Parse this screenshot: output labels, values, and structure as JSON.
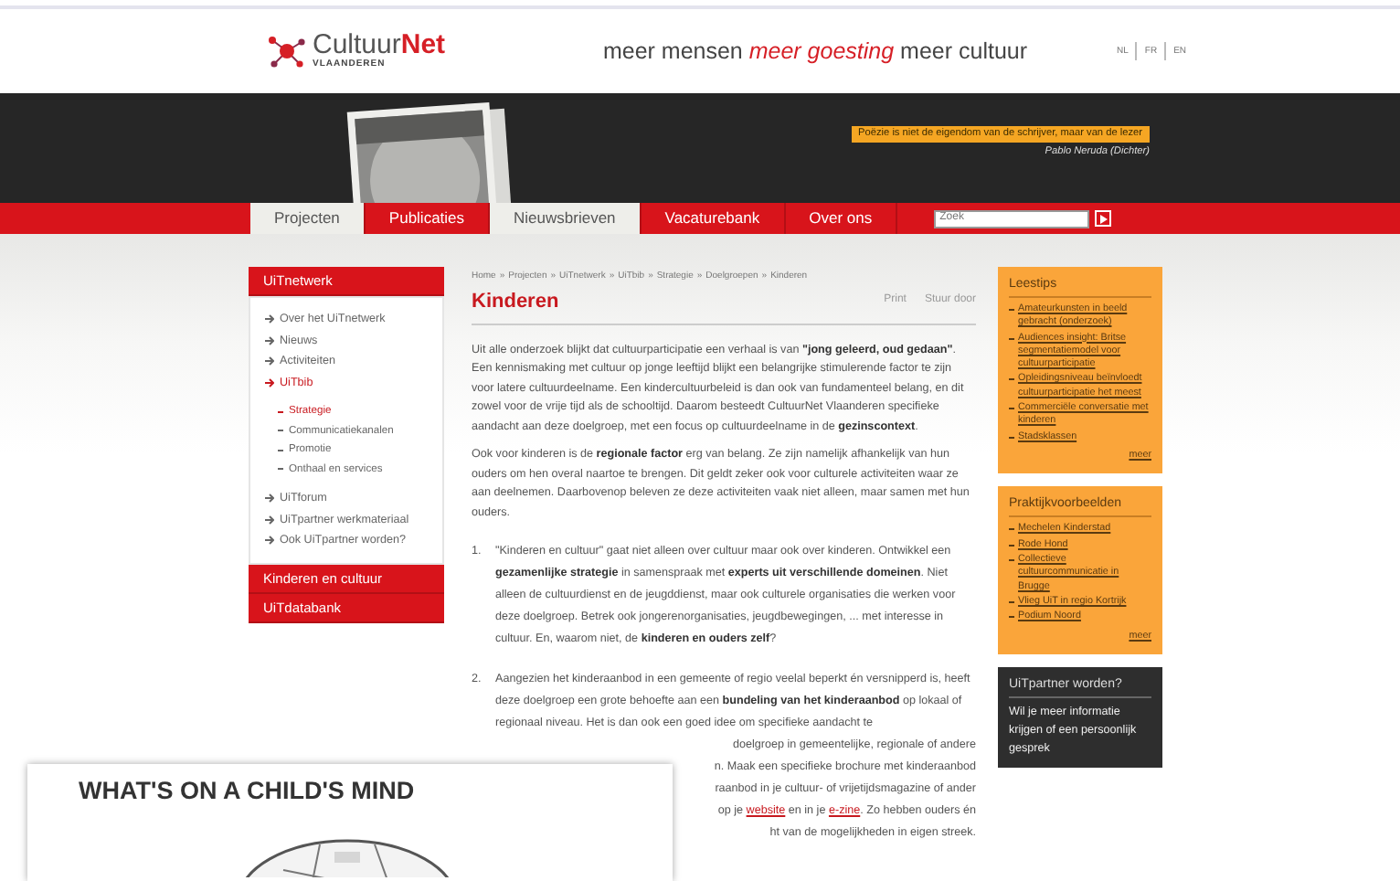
{
  "header": {
    "logo": {
      "brand_first": "Cultuur",
      "brand_second": "Net",
      "subtitle": "VLAANDEREN"
    },
    "tagline": "meer mensen *meer goesting* meer cultuur",
    "languages": [
      "NL",
      "FR",
      "EN"
    ]
  },
  "banner": {
    "quote": "Poëzie is niet de eigendom van de schrijver, maar van de lezer",
    "author": "Pablo Neruda (Dichter)"
  },
  "nav": {
    "tabs": [
      {
        "label": "Projecten",
        "selected": true
      },
      {
        "label": "Publicaties",
        "selected": false
      },
      {
        "label": "Nieuwsbrieven",
        "selected": true
      },
      {
        "label": "Vacaturebank",
        "selected": false
      },
      {
        "label": "Over ons",
        "selected": false
      }
    ],
    "search": {
      "placeholder": "Zoek"
    }
  },
  "sidebar": {
    "sections": [
      {
        "title": "UiTnetwerk",
        "expanded": true,
        "items": [
          {
            "label": "Over het UiTnetwerk",
            "selected": false
          },
          {
            "label": "Nieuws",
            "selected": false
          },
          {
            "label": "Activiteiten",
            "selected": false
          },
          {
            "label": "UiTbib",
            "selected": true,
            "children": [
              {
                "label": "Strategie",
                "selected": true
              },
              {
                "label": "Communicatiekanalen",
                "selected": false
              },
              {
                "label": "Promotie",
                "selected": false
              },
              {
                "label": "Onthaal en services",
                "selected": false
              }
            ]
          },
          {
            "label": "UiTforum",
            "selected": false
          },
          {
            "label": "UiTpartner werkmateriaal",
            "selected": false
          },
          {
            "label": "Ook UiTpartner worden?",
            "selected": false
          }
        ]
      },
      {
        "title": "Kinderen en cultuur",
        "expanded": false
      },
      {
        "title": "UiTdatabank",
        "expanded": false
      }
    ]
  },
  "main": {
    "breadcrumb": [
      "Home",
      "Projecten",
      "UiTnetwerk",
      "UiTbib",
      "Strategie",
      "Doelgroepen",
      "Kinderen"
    ],
    "breadcrumb_separator": "»",
    "title": "Kinderen",
    "actions": [
      "Print",
      "Stuur door"
    ],
    "paragraphs": [
      "Uit alle onderzoek blijkt dat cultuurparticipatie een verhaal is van **\"jong geleerd, oud gedaan\"**. Een kennismaking met cultuur op jonge leeftijd blijkt een belangrijke stimulerende factor te zijn voor latere cultuurdeelname. Een kindercultuurbeleid is dan ook van fundamenteel belang, en dit zowel voor de vrije tijd als de schooltijd. Daarom besteedt CultuurNet Vlaanderen specifieke aandacht aan deze doelgroep, met een focus op cultuurdeelname in de **gezinscontext**.",
      "Ook voor kinderen is de **regionale factor** erg van belang. Ze zijn namelijk afhankelijk van hun ouders om hen overal naartoe te brengen. Dit geldt zeker ook voor culturele activiteiten waar ze aan deelnemen. Daarbovenop beleven ze deze activiteiten vaak niet alleen, maar samen met hun ouders."
    ],
    "list": [
      {
        "number": "1.",
        "text": "\"Kinderen en cultuur\" gaat niet alleen over cultuur maar ook over kinderen. Ontwikkel een **gezamenlijke strategie** in samenspraak met **experts uit verschillende domeinen**. Niet alleen de cultuurdienst en de jeugddienst, maar ook culturele organisaties die werken voor deze doelgroep. Betrek ook jongerenorganisaties, jeugdbewegingen, ... met interesse in cultuur. En, waarom niet, de **kinderen en ouders zelf**?"
      },
      {
        "number": "2.",
        "text": "Aangezien het kinderaanbod in een gemeente of regio veelal beperkt én versnipperd is, heeft deze doelgroep een grote behoefte aan een **bundeling van het kinderaanbod** op lokaal of regionaal niveau. Het is dan ook een goed idee om specifieke aandacht te",
        "partial_lines": [
          [
            {
              "kind": "text",
              "text": "doelgroep in gemeentelijke, regionale of andere"
            }
          ],
          [
            {
              "kind": "text",
              "text": "n. Maak een specifieke brochure met kinderaanbod"
            }
          ],
          [
            {
              "kind": "text",
              "text": "raanbod in je cultuur- of vrijetijdsmagazine of ander"
            }
          ],
          [
            {
              "kind": "text",
              "text": "op je "
            },
            {
              "kind": "link",
              "text": "website"
            },
            {
              "kind": "text",
              "text": " en in je "
            },
            {
              "kind": "link",
              "text": "e-zine"
            },
            {
              "kind": "text",
              "text": ". Zo hebben ouders én"
            }
          ],
          [
            {
              "kind": "text",
              "text": "ht van de mogelijkheden in eigen streek."
            }
          ]
        ]
      }
    ]
  },
  "boxes": [
    {
      "kind": "orange",
      "title": "Leestips",
      "links": [
        "Amateurkunsten in beeld gebracht (onderzoek)",
        "Audiences insight: Britse segmentatiemodel voor cultuurparticipatie",
        "Opleidingsniveau beïnvloedt cultuurparticipatie het meest",
        "Commerciële conversatie met kinderen",
        "Stadsklassen"
      ],
      "more": "meer"
    },
    {
      "kind": "orange",
      "title": "Praktijkvoorbeelden",
      "links": [
        "Mechelen Kinderstad",
        "Rode Hond",
        "Collectieve cultuurcommunicatie in Brugge",
        "Vlieg UiT in regio Kortrijk",
        "Podium Noord"
      ],
      "more": "meer"
    },
    {
      "kind": "dark",
      "title": "UiTpartner worden?",
      "text": "Wil je meer informatie krijgen of een persoonlijk gesprek"
    }
  ],
  "overlay": {
    "title": "WHAT'S ON A CHILD'S MIND"
  }
}
